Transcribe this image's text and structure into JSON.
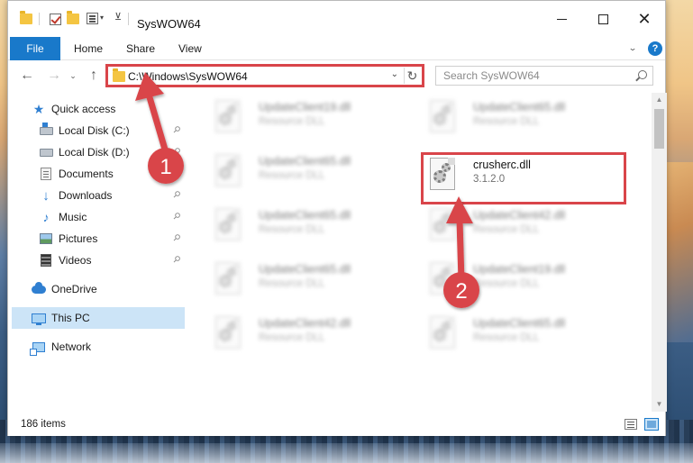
{
  "window": {
    "title": "SysWOW64",
    "minimize_glyph": "",
    "close_glyph": "✕"
  },
  "ribbon": {
    "tabs": [
      "File",
      "Home",
      "Share",
      "View"
    ],
    "help_glyph": "?",
    "collapse_glyph": "^"
  },
  "nav": {
    "back_glyph": "←",
    "forward_glyph": "→",
    "recent_glyph": "⌄",
    "up_glyph": "↑",
    "path": "C:\\Windows\\SysWOW64",
    "dropdown_glyph": "⌄",
    "refresh_glyph": "↻",
    "search_placeholder": "Search SysWOW64"
  },
  "sidebar": {
    "items": [
      {
        "label": "Quick access",
        "icon": "star-icon",
        "pinned": false
      },
      {
        "label": "Local Disk (C:)",
        "icon": "local-disk-icon",
        "pinned": true
      },
      {
        "label": "Local Disk (D:)",
        "icon": "local-disk-icon",
        "pinned": true
      },
      {
        "label": "Documents",
        "icon": "documents-icon",
        "pinned": true
      },
      {
        "label": "Downloads",
        "icon": "download-icon",
        "pinned": true
      },
      {
        "label": "Music",
        "icon": "music-icon",
        "pinned": true
      },
      {
        "label": "Pictures",
        "icon": "pictures-icon",
        "pinned": true
      },
      {
        "label": "Videos",
        "icon": "video-icon",
        "pinned": true
      },
      {
        "label": "OneDrive",
        "icon": "cloud-icon",
        "pinned": false
      },
      {
        "label": "This PC",
        "icon": "computer-icon",
        "pinned": false,
        "selected": true
      },
      {
        "label": "Network",
        "icon": "network-icon",
        "pinned": false
      }
    ],
    "pin_glyph": "📌"
  },
  "files": {
    "left_column": [
      {
        "name": "UpdateClient19.dll",
        "type": "Resource DLL"
      },
      {
        "name": "UpdateClient65.dll",
        "type": "Resource DLL"
      },
      {
        "name": "UpdateClient65.dll",
        "type": "Resource DLL"
      },
      {
        "name": "UpdateClient65.dll",
        "type": "Resource DLL"
      },
      {
        "name": "UpdateClient42.dll",
        "type": "Resource DLL"
      }
    ],
    "right_column": [
      {
        "name": "UpdateClient65.dll",
        "type": "Resource DLL"
      },
      {
        "name": "crusherc.dll",
        "type": "3.1.2.0",
        "highlighted": true
      },
      {
        "name": "UpdateClient42.dll",
        "type": "Resource DLL"
      },
      {
        "name": "UpdateClient19.dll",
        "type": "Resource DLL"
      },
      {
        "name": "UpdateClient65.dll",
        "type": "Resource DLL"
      }
    ]
  },
  "status": {
    "item_count": "186 items"
  },
  "callouts": {
    "step1": "1",
    "step2": "2",
    "color": "#d9454a"
  },
  "colors": {
    "accent": "#1979ca",
    "selection": "#cce4f7",
    "highlight": "#d9454a"
  }
}
